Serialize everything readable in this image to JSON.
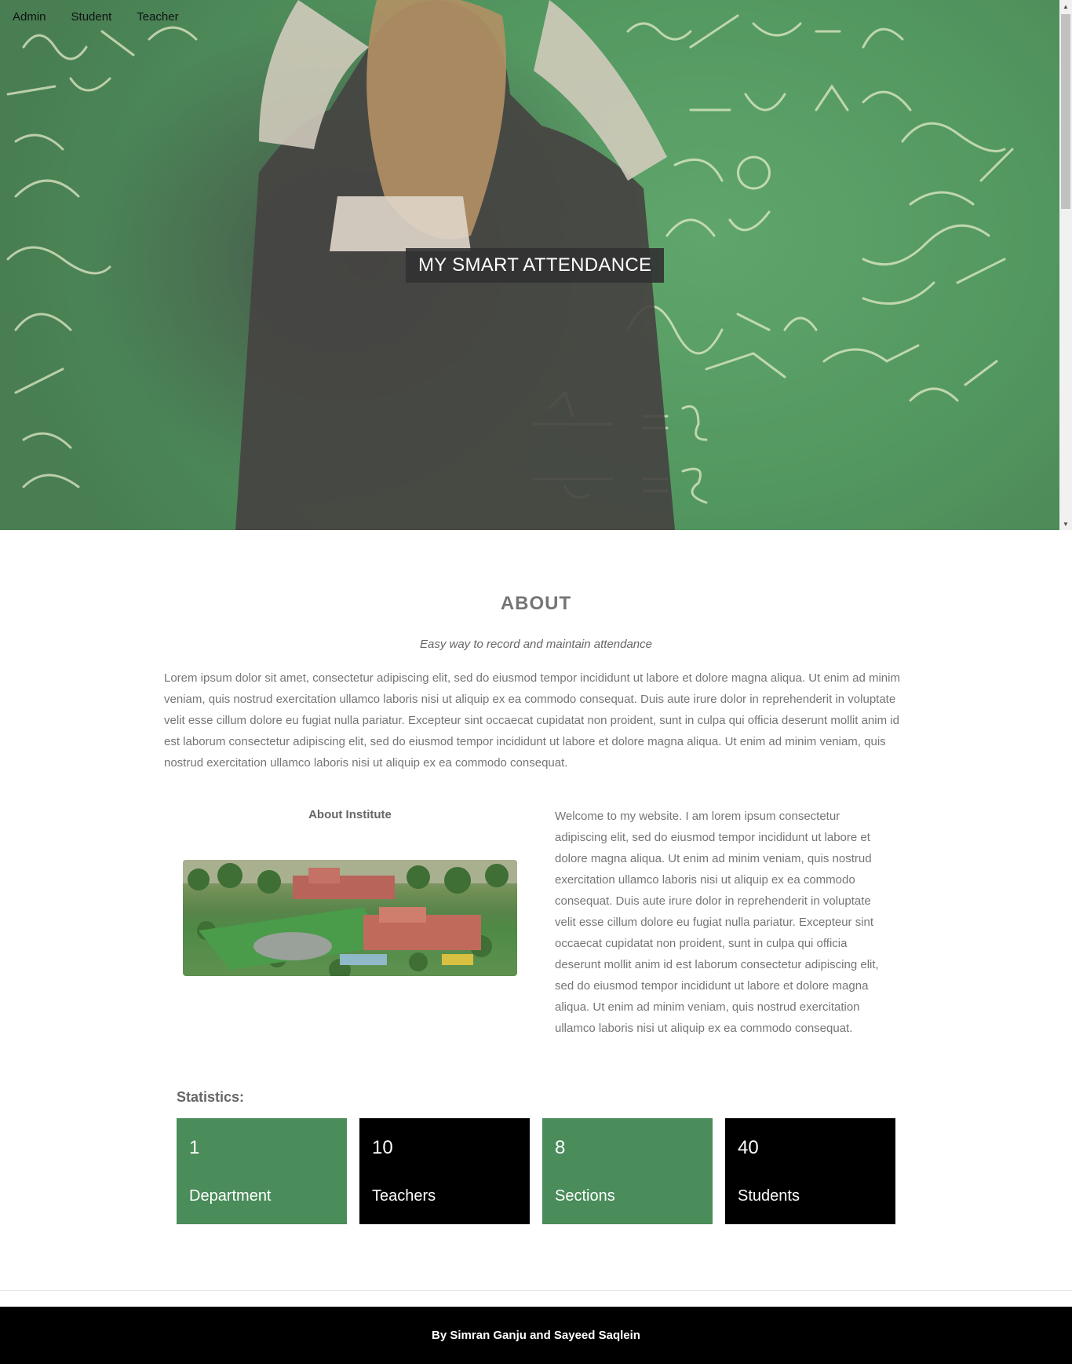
{
  "nav": {
    "items": [
      "Admin",
      "Student",
      "Teacher"
    ]
  },
  "hero": {
    "title": "MY SMART ATTENDANCE"
  },
  "about": {
    "heading": "ABOUT",
    "tagline": "Easy way to record and maintain attendance",
    "text": "Lorem ipsum dolor sit amet, consectetur adipiscing elit, sed do eiusmod tempor incididunt ut labore et dolore magna aliqua. Ut enim ad minim veniam, quis nostrud exercitation ullamco laboris nisi ut aliquip ex ea commodo consequat. Duis aute irure dolor in reprehenderit in voluptate velit esse cillum dolore eu fugiat nulla pariatur. Excepteur sint occaecat cupidatat non proident, sunt in culpa qui officia deserunt mollit anim id est laborum consectetur adipiscing elit, sed do eiusmod tempor incididunt ut labore et dolore magna aliqua. Ut enim ad minim veniam, quis nostrud exercitation ullamco laboris nisi ut aliquip ex ea commodo consequat."
  },
  "institute": {
    "heading": "About Institute",
    "welcome": "Welcome to my website. I am lorem ipsum consectetur adipiscing elit, sed do eiusmod tempor incididunt ut labore et dolore magna aliqua. Ut enim ad minim veniam, quis nostrud exercitation ullamco laboris nisi ut aliquip ex ea commodo consequat. Duis aute irure dolor in reprehenderit in voluptate velit esse cillum dolore eu fugiat nulla pariatur. Excepteur sint occaecat cupidatat non proident, sunt in culpa qui officia deserunt mollit anim id est laborum consectetur adipiscing elit, sed do eiusmod tempor incididunt ut labore et dolore magna aliqua. Ut enim ad minim veniam, quis nostrud exercitation ullamco laboris nisi ut aliquip ex ea commodo consequat."
  },
  "statistics": {
    "heading": "Statistics:",
    "cards": [
      {
        "value": "1",
        "label": "Department",
        "color": "#4a8c5a"
      },
      {
        "value": "10",
        "label": "Teachers",
        "color": "#000000"
      },
      {
        "value": "8",
        "label": "Sections",
        "color": "#4a8c5a"
      },
      {
        "value": "40",
        "label": "Students",
        "color": "#000000"
      }
    ]
  },
  "footer": {
    "credit": "By Simran Ganju and Sayeed Saqlein"
  },
  "colors": {
    "accent_green": "#4a8c5a",
    "footer_bg": "#000000",
    "hero_title_bg": "#323232"
  }
}
